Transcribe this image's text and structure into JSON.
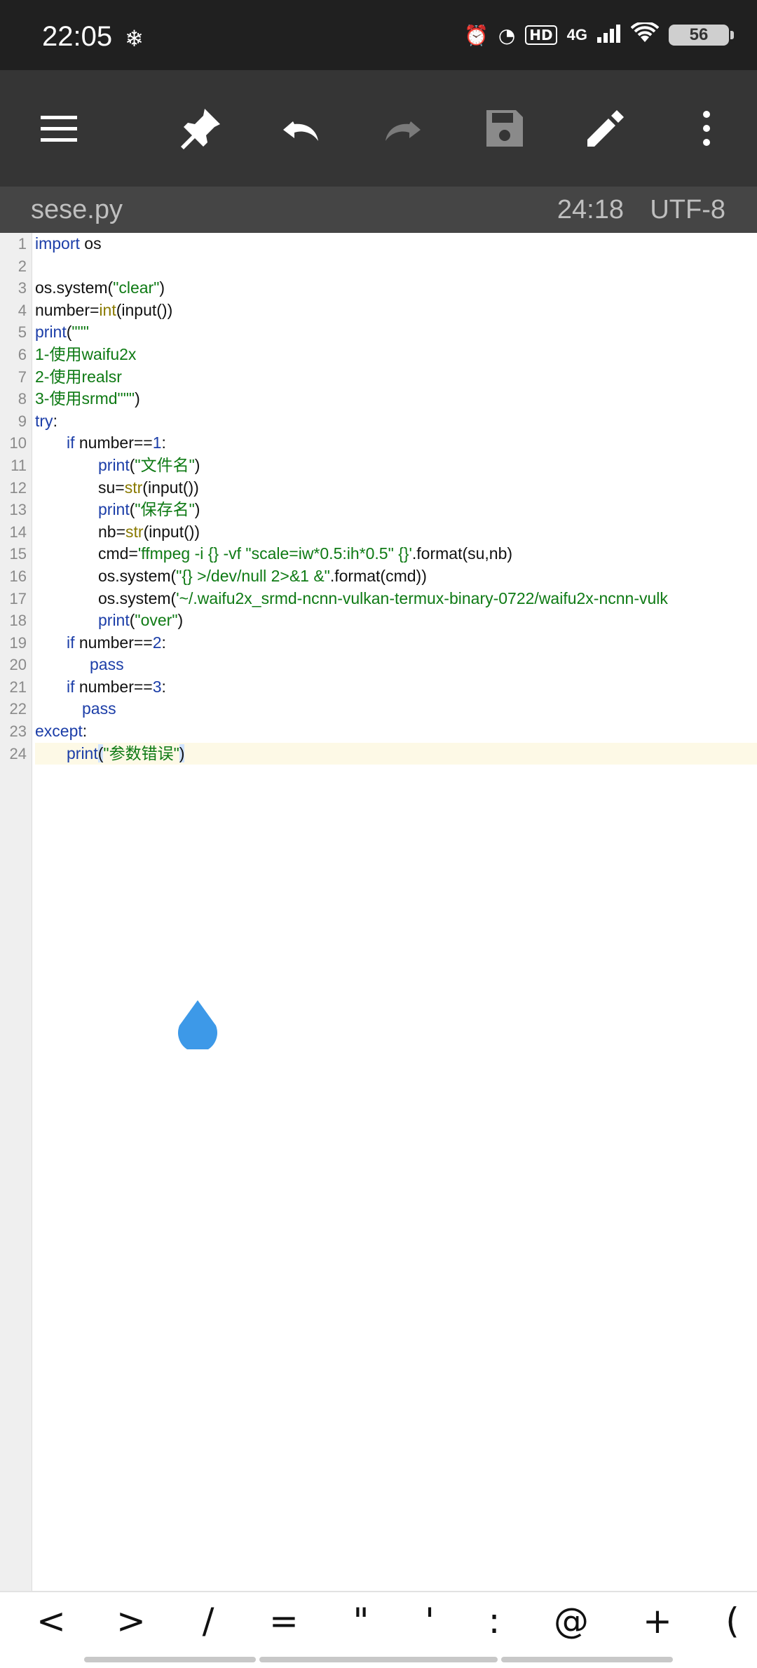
{
  "status": {
    "time": "22:05",
    "battery": "56",
    "network": "4G",
    "hd": "HD"
  },
  "file": {
    "name": "sese.py",
    "position": "24:18",
    "encoding": "UTF-8"
  },
  "line_numbers": [
    "1",
    "2",
    "3",
    "4",
    "5",
    "6",
    "7",
    "8",
    "9",
    "10",
    "11",
    "12",
    "13",
    "14",
    "15",
    "16",
    "17",
    "18",
    "19",
    "20",
    "21",
    "22",
    "23",
    "24"
  ],
  "code": {
    "l1_kw": "import",
    "l1_rest": " os",
    "l3_a": "os.system(",
    "l3_s": "\"clear\"",
    "l3_b": ")",
    "l4_a": "number=",
    "l4_bi": "int",
    "l4_b": "(input())",
    "l5_kw": "print",
    "l5_a": "(",
    "l5_s": "\"\"\"",
    "l6": "1-使用waifu2x",
    "l7": "2-使用realsr",
    "l8_s": "3-使用srmd\"\"\"",
    "l8_b": ")",
    "l9_kw": "try",
    "l9_b": ":",
    "l10_kw": "if",
    "l10_a": " number==",
    "l10_n": "1",
    "l10_b": ":",
    "l11_kw": "print",
    "l11_a": "(",
    "l11_s": "\"文件名\"",
    "l11_b": ")",
    "l12_a": "su=",
    "l12_bi": "str",
    "l12_b": "(input())",
    "l13_kw": "print",
    "l13_a": "(",
    "l13_s": "\"保存名\"",
    "l13_b": ")",
    "l14_a": "nb=",
    "l14_bi": "str",
    "l14_b": "(input())",
    "l15_a": "cmd=",
    "l15_s": "'ffmpeg -i {} -vf \"scale=iw*0.5:ih*0.5\" {}'",
    "l15_b": ".format(su,nb)",
    "l16_a": "os.system(",
    "l16_s": "\"{} >/dev/null 2>&1 &\"",
    "l16_b": ".format(cmd))",
    "l17_a": "os.system(",
    "l17_s": "'~/.waifu2x_srmd-ncnn-vulkan-termux-binary-0722/waifu2x-ncnn-vulk",
    "l18_kw": "print",
    "l18_a": "(",
    "l18_s": "\"over\"",
    "l18_b": ")",
    "l19_kw": "if",
    "l19_a": " number==",
    "l19_n": "2",
    "l19_b": ":",
    "l20_kw": "pass",
    "l21_kw": "if",
    "l21_a": " number==",
    "l21_n": "3",
    "l21_b": ":",
    "l22_kw": "pass",
    "l23_kw": "except",
    "l23_b": ":",
    "l24_kw": "print",
    "l24_a": "(",
    "l24_s": "\"参数错误\"",
    "l24_b": ")"
  },
  "symbols": [
    "<",
    ">",
    "/",
    "=",
    "\"",
    "'",
    ":",
    "@",
    "+",
    "("
  ],
  "icons": {
    "menu": "menu-icon",
    "pin": "pin-icon",
    "undo": "undo-icon",
    "redo": "redo-icon",
    "save": "save-icon",
    "edit": "edit-icon",
    "more": "more-icon"
  },
  "colors": {
    "toolbar": "#353535",
    "statusbar": "#202020",
    "keyword": "#1c3ea8",
    "string": "#0e7a14",
    "builtin": "#8a7a00",
    "caret": "#3d99e8"
  }
}
